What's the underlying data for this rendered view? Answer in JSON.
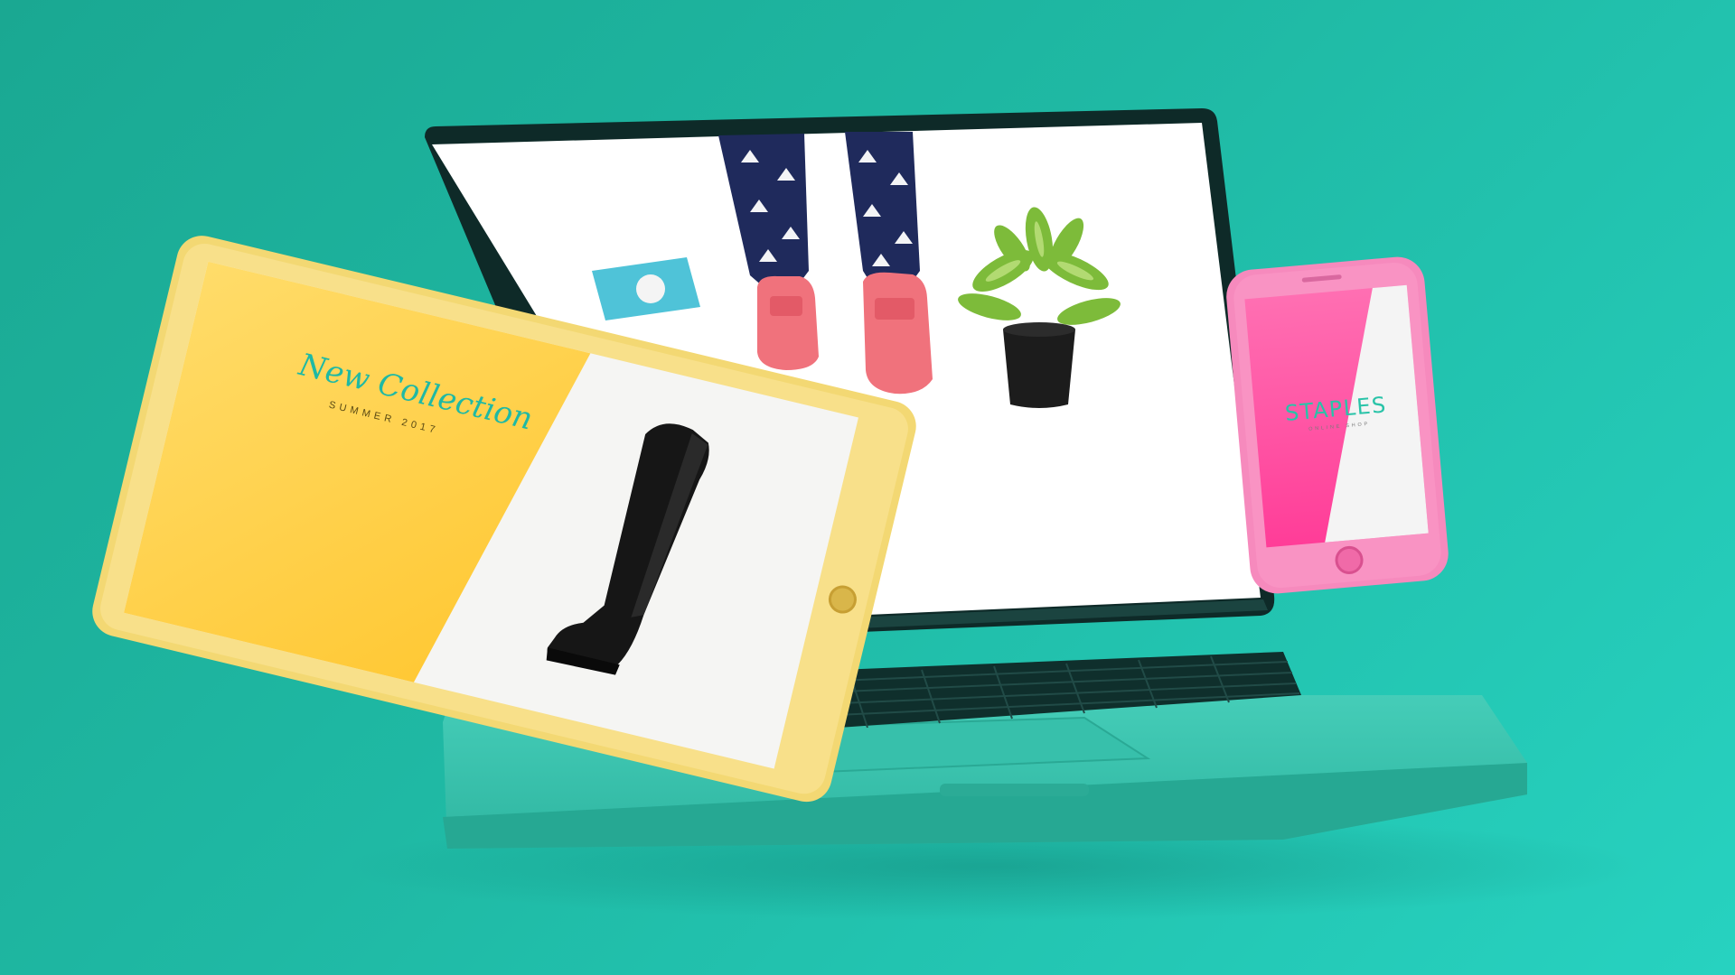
{
  "tablet": {
    "title": "New Collection",
    "subtitle": "SUMMER 2017"
  },
  "phone": {
    "brand": "STAPLES",
    "subtitle": "ONLINE SHOP"
  },
  "colors": {
    "background": "#1fb9a4",
    "laptop_body": "#3ec7b2",
    "laptop_bezel": "#0e2a28",
    "tablet_frame": "#f3d873",
    "tablet_panel": "#ffd34d",
    "tablet_title": "#1fb9a4",
    "phone_body": "#f68abd",
    "phone_screen": "#ff4fa0",
    "phone_brand": "#29c3a8"
  },
  "icons": {
    "tablet_home_button": "home-button-icon",
    "phone_home_button": "home-button-icon",
    "phone_speaker": "speaker-grille-icon"
  }
}
